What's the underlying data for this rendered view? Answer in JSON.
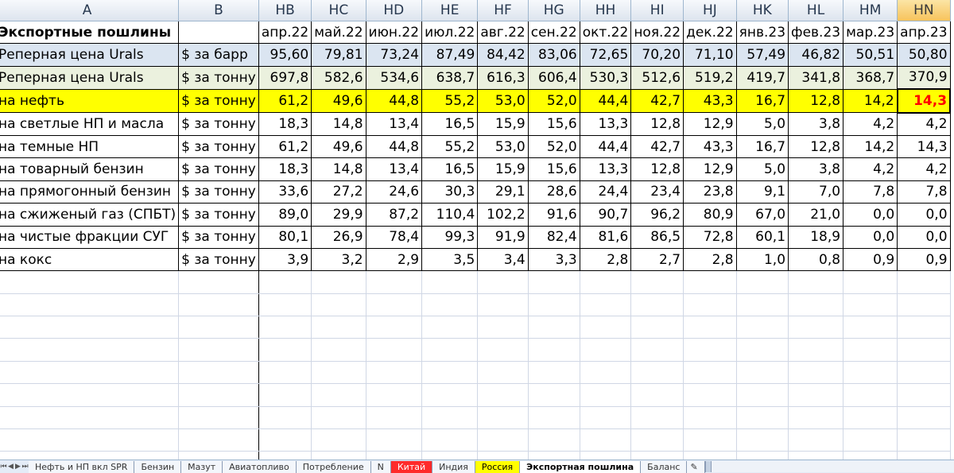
{
  "columns": [
    "A",
    "B",
    "HB",
    "HC",
    "HD",
    "HE",
    "HF",
    "HG",
    "HH",
    "HI",
    "HJ",
    "HK",
    "HL",
    "HM",
    "HN"
  ],
  "title_row": {
    "label": "Экспортные пошлины",
    "unit": "",
    "months": [
      "апр.22",
      "май.22",
      "июн.22",
      "июл.22",
      "авг.22",
      "сен.22",
      "окт.22",
      "ноя.22",
      "дек.22",
      "янв.23",
      "фев.23",
      "мар.23",
      "апр.23"
    ]
  },
  "rows": [
    {
      "label": "Реперная цена Urals",
      "unit": "$ за барр",
      "values": [
        "95,60",
        "79,81",
        "73,24",
        "87,49",
        "84,42",
        "83,06",
        "72,65",
        "70,20",
        "71,10",
        "57,49",
        "46,82",
        "50,51",
        "50,80"
      ]
    },
    {
      "label": "Реперная цена Urals",
      "unit": "$ за тонну",
      "values": [
        "697,8",
        "582,6",
        "534,6",
        "638,7",
        "616,3",
        "606,4",
        "530,3",
        "512,6",
        "519,2",
        "419,7",
        "341,8",
        "368,7",
        "370,9"
      ]
    },
    {
      "label": "на нефть",
      "unit": "$ за тонну",
      "values": [
        "61,2",
        "49,6",
        "44,8",
        "55,2",
        "53,0",
        "52,0",
        "44,4",
        "42,7",
        "43,3",
        "16,7",
        "12,8",
        "14,2",
        "14,3"
      ]
    },
    {
      "label": "на светлые НП и масла",
      "unit": "$ за тонну",
      "values": [
        "18,3",
        "14,8",
        "13,4",
        "16,5",
        "15,9",
        "15,6",
        "13,3",
        "12,8",
        "12,9",
        "5,0",
        "3,8",
        "4,2",
        "4,2"
      ]
    },
    {
      "label": "на темные НП",
      "unit": "$ за тонну",
      "values": [
        "61,2",
        "49,6",
        "44,8",
        "55,2",
        "53,0",
        "52,0",
        "44,4",
        "42,7",
        "43,3",
        "16,7",
        "12,8",
        "14,2",
        "14,3"
      ]
    },
    {
      "label": "на товарный бензин",
      "unit": "$ за тонну",
      "values": [
        "18,3",
        "14,8",
        "13,4",
        "16,5",
        "15,9",
        "15,6",
        "13,3",
        "12,8",
        "12,9",
        "5,0",
        "3,8",
        "4,2",
        "4,2"
      ]
    },
    {
      "label": "на прямогонный бензин",
      "unit": "$ за тонну",
      "values": [
        "33,6",
        "27,2",
        "24,6",
        "30,3",
        "29,1",
        "28,6",
        "24,4",
        "23,4",
        "23,8",
        "9,1",
        "7,0",
        "7,8",
        "7,8"
      ]
    },
    {
      "label": "на сжиженый газ (СПБТ)",
      "unit": "$ за тонну",
      "values": [
        "89,0",
        "29,9",
        "87,2",
        "110,4",
        "102,2",
        "91,6",
        "90,7",
        "96,2",
        "80,9",
        "67,0",
        "21,0",
        "0,0",
        "0,0"
      ]
    },
    {
      "label": "на чистые фракции СУГ",
      "unit": "$ за тонну",
      "values": [
        "80,1",
        "26,9",
        "78,4",
        "99,3",
        "91,9",
        "82,4",
        "81,6",
        "86,5",
        "72,8",
        "60,1",
        "18,9",
        "0,0",
        "0,0"
      ]
    },
    {
      "label": "на кокс",
      "unit": "$ за тонну",
      "values": [
        "3,9",
        "3,2",
        "2,9",
        "3,5",
        "3,4",
        "3,3",
        "2,8",
        "2,7",
        "2,8",
        "1,0",
        "0,8",
        "0,9",
        "0,9"
      ]
    }
  ],
  "selected_column": "HN",
  "tabs": [
    {
      "label": "Нефть и НП вкл SPR",
      "style": "normal"
    },
    {
      "label": "Бензин",
      "style": "normal"
    },
    {
      "label": "Мазут",
      "style": "normal"
    },
    {
      "label": "Авиатопливо",
      "style": "normal"
    },
    {
      "label": "Потребление",
      "style": "normal"
    },
    {
      "label": "N",
      "style": "normal"
    },
    {
      "label": "Китай",
      "style": "red"
    },
    {
      "label": "Индия",
      "style": "normal"
    },
    {
      "label": "Россия",
      "style": "yellow"
    },
    {
      "label": "Экспортная пошлина",
      "style": "active"
    },
    {
      "label": "Баланс",
      "style": "normal"
    }
  ],
  "colors": {
    "selection_red": "#ff0000",
    "highlight_yellow": "#ffff00",
    "blue_row": "#dbe5f1",
    "green_row": "#ebf1de"
  },
  "icons": {
    "insert_sheet": "insert-sheet-icon"
  }
}
